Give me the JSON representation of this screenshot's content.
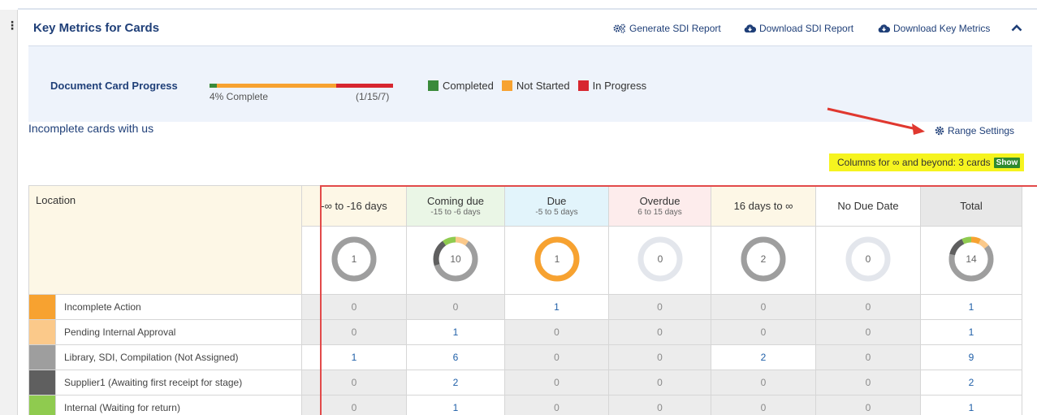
{
  "header": {
    "title": "Key Metrics for Cards",
    "generate_sdi": "Generate SDI Report",
    "download_sdi": "Download SDI Report",
    "download_metrics": "Download Key Metrics",
    "collapse_icon": "chevron-up-icon"
  },
  "progress": {
    "label": "Document Card Progress",
    "percent_text": "4% Complete",
    "ratio_text": "(1/15/7)",
    "completed_fraction": 0.04,
    "not_started_fraction": 0.65,
    "in_progress_fraction": 0.31,
    "legend": [
      {
        "label": "Completed",
        "color": "#3a8a3a"
      },
      {
        "label": "Not Started",
        "color": "#f7a230"
      },
      {
        "label": "In Progress",
        "color": "#d7262f"
      }
    ]
  },
  "section": {
    "title": "Incomplete cards with us",
    "range_settings": "Range Settings"
  },
  "notice": {
    "text": "Columns for ∞ and beyond: 3 cards",
    "show_label": "Show"
  },
  "table": {
    "location_header": "Location",
    "columns": [
      {
        "label": "-∞ to -16 days",
        "sub": "",
        "bg": "#fdf7e6",
        "total": "1"
      },
      {
        "label": "Coming due",
        "sub": "-15 to -6 days",
        "bg": "#eaf6e6",
        "total": "10"
      },
      {
        "label": "Due",
        "sub": "-5 to 5 days",
        "bg": "#e2f4fb",
        "total": "1"
      },
      {
        "label": "Overdue",
        "sub": "6 to 15 days",
        "bg": "#fdecec",
        "total": "0"
      },
      {
        "label": "16 days to ∞",
        "sub": "",
        "bg": "#fdf7e6",
        "total": "2"
      },
      {
        "label": "No Due Date",
        "sub": "",
        "bg": "#ffffff",
        "total": "0"
      },
      {
        "label": "Total",
        "sub": "",
        "bg": "#e8e8e8",
        "total": "14"
      }
    ],
    "rows": [
      {
        "label": "Incomplete Action",
        "color": "#f7a230",
        "values": [
          "0",
          "0",
          "1",
          "0",
          "0",
          "0",
          "1"
        ]
      },
      {
        "label": "Pending Internal Approval",
        "color": "#fbc98a",
        "values": [
          "0",
          "1",
          "0",
          "0",
          "0",
          "0",
          "1"
        ]
      },
      {
        "label": "Library, SDI, Compilation (Not Assigned)",
        "color": "#9e9e9e",
        "values": [
          "1",
          "6",
          "0",
          "0",
          "2",
          "0",
          "9"
        ]
      },
      {
        "label": "Supplier1 (Awaiting first receipt for stage)",
        "color": "#5f5f5f",
        "values": [
          "0",
          "2",
          "0",
          "0",
          "0",
          "0",
          "2"
        ]
      },
      {
        "label": "Internal (Waiting for return)",
        "color": "#8fcb4f",
        "values": [
          "0",
          "1",
          "0",
          "0",
          "0",
          "0",
          "1"
        ]
      }
    ]
  }
}
